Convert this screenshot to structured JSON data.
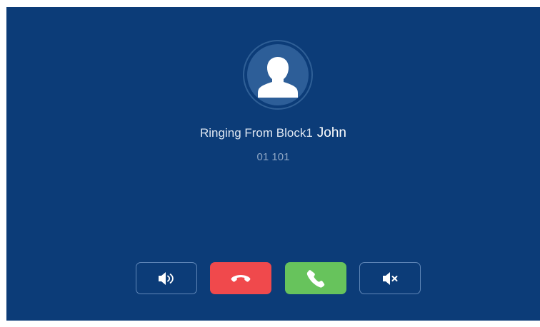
{
  "call": {
    "status_prefix": "Ringing From Block1",
    "caller_name": "John",
    "caller_number": "01 101"
  },
  "controls": [
    {
      "name": "speaker",
      "icon": "speaker-volume-icon"
    },
    {
      "name": "hang-up",
      "icon": "phone-hangup-icon",
      "color": "#f0494c"
    },
    {
      "name": "answer",
      "icon": "phone-answer-icon",
      "color": "#67c35c"
    },
    {
      "name": "mute",
      "icon": "speaker-mute-icon"
    }
  ],
  "colors": {
    "background": "#0c3c78",
    "avatar": "#2d5e98",
    "hangup": "#f0494c",
    "answer": "#67c35c",
    "secondary_text": "#8ea6c4"
  }
}
